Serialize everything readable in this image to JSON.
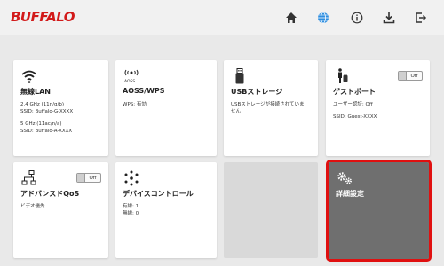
{
  "header": {
    "logo": "BUFFALO",
    "icons": [
      "home-icon",
      "globe-icon",
      "info-icon",
      "download-icon",
      "logout-icon"
    ]
  },
  "tiles": {
    "wireless": {
      "title": "無線LAN",
      "lines": [
        "2.4 GHz (11n/g/b)",
        "SSID: Buffalo-G-XXXX",
        "5 GHz (11ac/n/a)",
        "SSID: Buffalo-A-XXXX"
      ]
    },
    "aoss": {
      "title": "AOSS/WPS",
      "icon_caption": "AOSS",
      "lines": [
        "WPS: 有効"
      ]
    },
    "usb": {
      "title": "USBストレージ",
      "lines": [
        "USBストレージが接続されていま",
        "せん"
      ]
    },
    "guest": {
      "title": "ゲストポート",
      "toggle": "Off",
      "lines": [
        "ユーザー認証: Off",
        "SSID: Guest-XXXX"
      ]
    },
    "qos": {
      "title": "アドバンスドQoS",
      "toggle": "Off",
      "lines": [
        "ビデオ優先"
      ]
    },
    "devices": {
      "title": "デバイスコントロール",
      "lines": [
        "有線: 1",
        "無線: 0"
      ]
    },
    "advanced": {
      "title": "詳細設定"
    }
  },
  "colors": {
    "brand": "#d21a1a",
    "highlight": "#e01010",
    "advanced_bg": "#6f6f6f"
  }
}
